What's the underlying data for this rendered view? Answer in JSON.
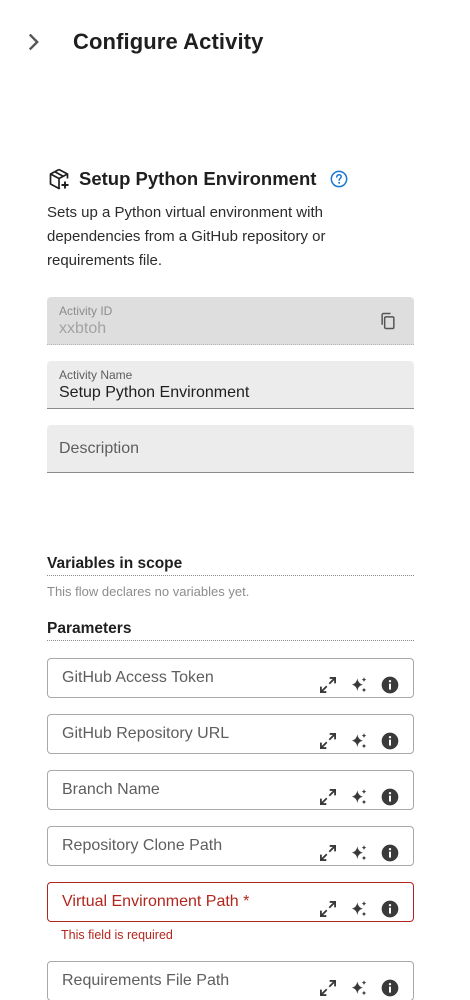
{
  "header": {
    "title": "Configure Activity",
    "collapse_icon": "chevron-right-icon"
  },
  "activity": {
    "title": "Setup Python Environment",
    "description": "Sets up a Python virtual environment with dependencies from a GitHub repository or requirements file.",
    "icon": "package-add-icon",
    "help_icon": "help-circle-icon"
  },
  "fields": {
    "activity_id": {
      "label": "Activity ID",
      "value": "xxbtoh"
    },
    "activity_name": {
      "label": "Activity Name",
      "value": "Setup Python Environment"
    },
    "description": {
      "placeholder": "Description"
    }
  },
  "variables": {
    "title": "Variables in scope",
    "empty_text": "This flow declares no variables yet."
  },
  "parameters": {
    "title": "Parameters",
    "items": [
      {
        "label": "GitHub Access Token"
      },
      {
        "label": "GitHub Repository URL"
      },
      {
        "label": "Branch Name"
      },
      {
        "label": "Repository Clone Path"
      },
      {
        "label": "Virtual Environment Path *",
        "error": "This field is required"
      },
      {
        "label": "Requirements File Path"
      }
    ]
  },
  "colors": {
    "error": "#b3261e",
    "help": "#1976d2",
    "field_bg": "#ececec"
  }
}
